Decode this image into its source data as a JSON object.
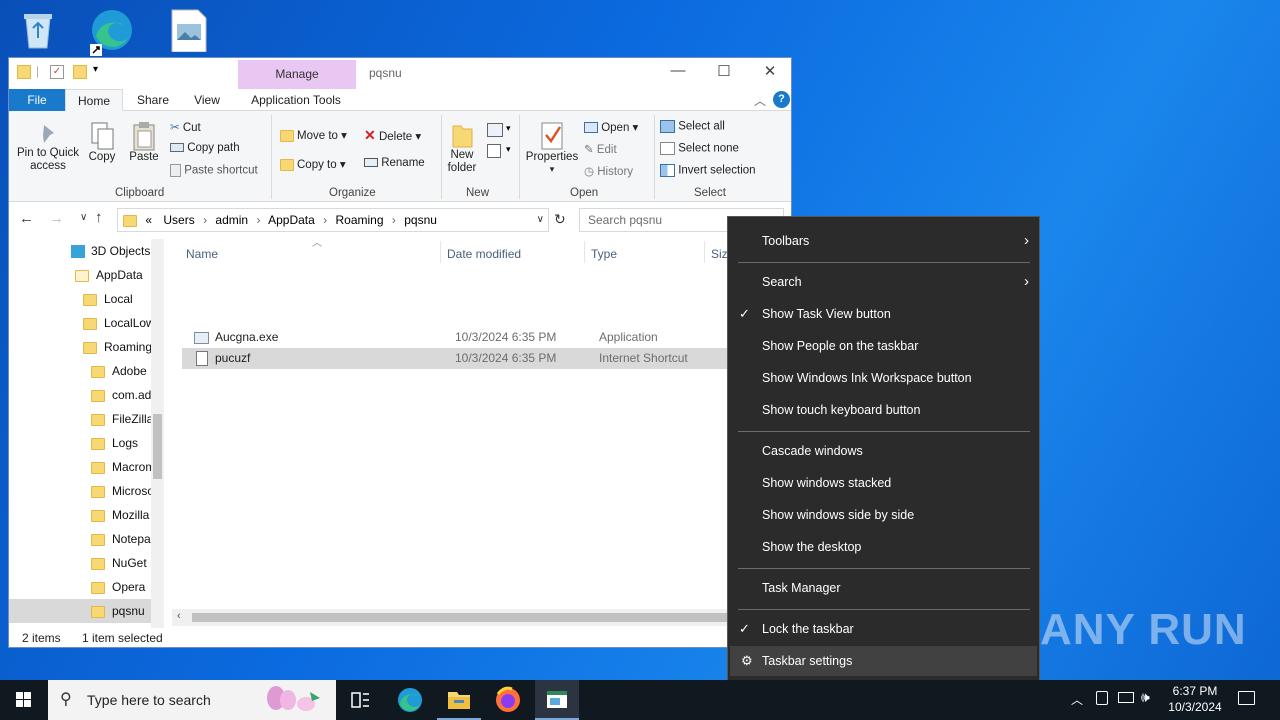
{
  "desktop": {
    "icons": [
      "recycle-bin-icon",
      "edge-shortcut-icon",
      "image-file-icon"
    ],
    "watermark": "ANY RUN"
  },
  "window": {
    "title": "pqsnu",
    "contextual_tab_group": "Manage",
    "tabs": [
      "File",
      "Home",
      "Share",
      "View",
      "Application Tools"
    ],
    "minimize": "—",
    "maximize": "☐",
    "close": "✕"
  },
  "ribbon": {
    "clipboard": {
      "pin": "Pin to Quick access",
      "copy": "Copy",
      "paste": "Paste",
      "cut": "Cut",
      "copy_path": "Copy path",
      "paste_shortcut": "Paste shortcut",
      "group": "Clipboard"
    },
    "organize": {
      "move_to": "Move to",
      "delete": "Delete",
      "copy_to": "Copy to",
      "rename": "Rename",
      "group": "Organize"
    },
    "new": {
      "new_folder": "New folder",
      "group": "New"
    },
    "open": {
      "properties": "Properties",
      "open": "Open",
      "edit": "Edit",
      "history": "History",
      "group": "Open"
    },
    "select": {
      "select_all": "Select all",
      "select_none": "Select none",
      "invert": "Invert selection",
      "group": "Select"
    }
  },
  "address": {
    "prefix": "«",
    "crumbs": [
      "Users",
      "admin",
      "AppData",
      "Roaming",
      "pqsnu"
    ],
    "search_placeholder": "Search pqsnu"
  },
  "nav": {
    "items": [
      {
        "label": "3D Objects"
      },
      {
        "label": "AppData"
      },
      {
        "label": "Local"
      },
      {
        "label": "LocalLow"
      },
      {
        "label": "Roaming"
      },
      {
        "label": "Adobe"
      },
      {
        "label": "com.adobe"
      },
      {
        "label": "FileZilla"
      },
      {
        "label": "Logs"
      },
      {
        "label": "Macromedia"
      },
      {
        "label": "Microsoft"
      },
      {
        "label": "Mozilla"
      },
      {
        "label": "Notepad++"
      },
      {
        "label": "NuGet"
      },
      {
        "label": "Opera"
      },
      {
        "label": "pqsnu"
      }
    ]
  },
  "files": {
    "columns": [
      "Name",
      "Date modified",
      "Type",
      "Size"
    ],
    "rows": [
      {
        "name": "Aucgna.exe",
        "date": "10/3/2024 6:35 PM",
        "type": "Application"
      },
      {
        "name": "pucuzf",
        "date": "10/3/2024 6:35 PM",
        "type": "Internet Shortcut"
      }
    ]
  },
  "status": {
    "items": "2 items",
    "selected": "1 item selected"
  },
  "context_menu": {
    "items": [
      {
        "label": "Toolbars",
        "submenu": true
      },
      {
        "label": "Search",
        "submenu": true
      },
      {
        "label": "Show Task View button",
        "checked": true
      },
      {
        "label": "Show People on the taskbar"
      },
      {
        "label": "Show Windows Ink Workspace button"
      },
      {
        "label": "Show touch keyboard button"
      },
      {
        "label": "Cascade windows"
      },
      {
        "label": "Show windows stacked"
      },
      {
        "label": "Show windows side by side"
      },
      {
        "label": "Show the desktop"
      },
      {
        "label": "Task Manager"
      },
      {
        "label": "Lock the taskbar",
        "checked": true
      },
      {
        "label": "Taskbar settings"
      }
    ],
    "check": "✓",
    "arrow": "›",
    "gear": "⚙"
  },
  "taskbar": {
    "search_placeholder": "Type here to search",
    "time": "6:37 PM",
    "date": "10/3/2024",
    "colors": {
      "background": "#101820",
      "accent": "#1979ca"
    }
  }
}
